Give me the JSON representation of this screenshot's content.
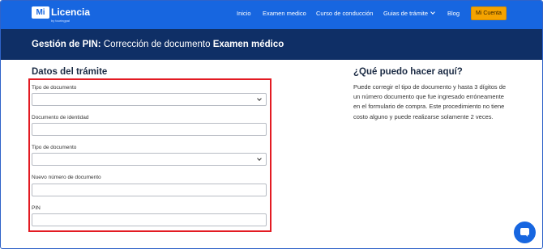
{
  "header": {
    "logo_mark": "Mi",
    "logo_text": "Licencia",
    "logo_sub": "by touringpal",
    "nav": [
      {
        "label": "Inicio"
      },
      {
        "label": "Examen medico"
      },
      {
        "label": "Curso de conducción"
      },
      {
        "label": "Guias de trámite"
      },
      {
        "label": "Blog"
      }
    ],
    "account_button": "Mi Cuenta"
  },
  "banner": {
    "prefix": "Gestión de PIN:",
    "middle": "Corrección de documento",
    "suffix": "Examen médico"
  },
  "form": {
    "title": "Datos del trámite",
    "fields": [
      {
        "label": "Tipo de documento",
        "type": "select",
        "value": ""
      },
      {
        "label": "Documento de identidad",
        "type": "text",
        "value": ""
      },
      {
        "label": "Tipo de documento",
        "type": "select",
        "value": ""
      },
      {
        "label": "Nuevo número de documento",
        "type": "text",
        "value": ""
      },
      {
        "label": "PIN",
        "type": "text",
        "value": ""
      }
    ]
  },
  "help": {
    "title": "¿Qué puedo hacer aquí?",
    "text": "Puede corregir el tipo de documento y hasta 3 dígitos de un número documento que fue ingresado erróneamente en el formulario de compra. Este procedimiento no tiene costo alguno y puede realizarse solamente 2 veces."
  },
  "icons": {
    "chat": "chat-icon",
    "chevron": "chevron-down-icon"
  },
  "colors": {
    "nav_blue": "#1766e0",
    "banner_navy": "#0f2f66",
    "accent_orange": "#f5a300",
    "highlight_red": "#e31b23"
  }
}
